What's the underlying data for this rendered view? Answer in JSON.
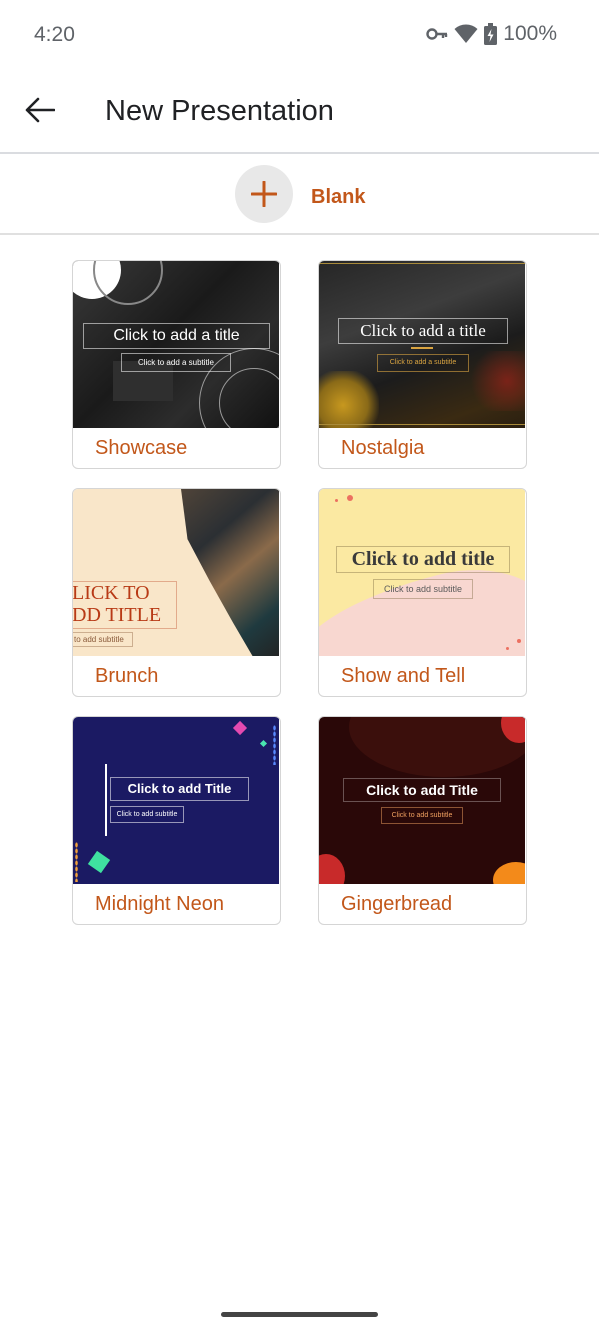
{
  "status": {
    "time": "4:20",
    "battery": "100%"
  },
  "header": {
    "title": "New Presentation"
  },
  "blank": {
    "label": "Blank"
  },
  "templates": [
    {
      "name": "Showcase",
      "title_ph": "Click to add a title",
      "subtitle_ph": "Click to add a subtitle"
    },
    {
      "name": "Nostalgia",
      "title_ph": "Click to add a title",
      "subtitle_ph": "Click to add a subtitle"
    },
    {
      "name": "Brunch",
      "title_ph": "LICK TO\nDD TITLE",
      "subtitle_ph": "to add subtitle"
    },
    {
      "name": "Show and Tell",
      "title_ph": "Click to add title",
      "subtitle_ph": "Click to add subtitle"
    },
    {
      "name": "Midnight Neon",
      "title_ph": "Click to add Title",
      "subtitle_ph": "Click to add subtitle"
    },
    {
      "name": "Gingerbread",
      "title_ph": "Click to add Title",
      "subtitle_ph": "Click to add subtitle"
    }
  ],
  "colors": {
    "accent": "#c2571a",
    "divider": "#dadce0"
  },
  "icons": {
    "back": "arrow-back-icon",
    "add": "plus-icon"
  }
}
